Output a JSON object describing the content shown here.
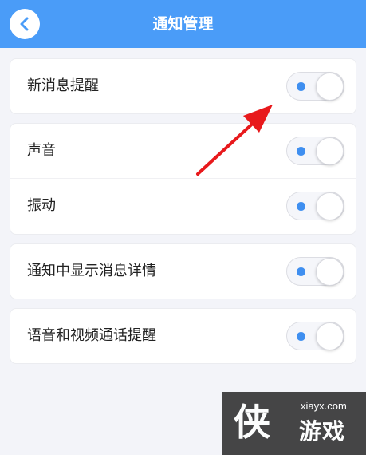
{
  "header": {
    "title": "通知管理",
    "back_icon": "chevron-left-icon",
    "color": "#4a9cf8"
  },
  "settings": {
    "new_message_reminder": {
      "label": "新消息提醒",
      "enabled": true
    },
    "sound": {
      "label": "声音",
      "enabled": true
    },
    "vibration": {
      "label": "振动",
      "enabled": true
    },
    "show_message_details": {
      "label": "通知中显示消息详情",
      "enabled": true
    },
    "voice_video_call_reminder": {
      "label": "语音和视频通话提醒",
      "enabled": true
    }
  },
  "toggle_accent": "#3f8ff0",
  "annotation": {
    "arrow_color": "#e8191c"
  },
  "watermark": {
    "site": "xiayx.com",
    "logo_char": "侠",
    "name": "游戏"
  }
}
